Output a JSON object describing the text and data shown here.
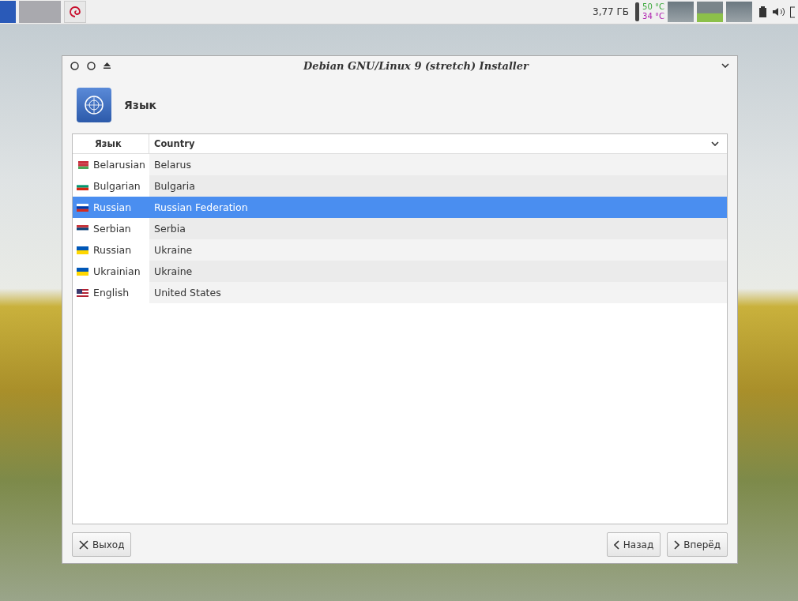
{
  "panel": {
    "memory": "3,77 ГБ",
    "temp_1": "50 °C",
    "temp_2": "34 °C"
  },
  "window": {
    "title": "Debian GNU/Linux 9 (stretch) Installer"
  },
  "header": {
    "title": "Язык"
  },
  "table": {
    "columns": [
      "Язык",
      "Country"
    ],
    "rows": [
      {
        "flag": {
          "kind": "by"
        },
        "language": "Belarusian",
        "country": "Belarus",
        "selected": false
      },
      {
        "flag": {
          "kind": "bg"
        },
        "language": "Bulgarian",
        "country": "Bulgaria",
        "selected": false
      },
      {
        "flag": {
          "kind": "ru"
        },
        "language": "Russian",
        "country": "Russian Federation",
        "selected": true
      },
      {
        "flag": {
          "kind": "rs"
        },
        "language": "Serbian",
        "country": "Serbia",
        "selected": false
      },
      {
        "flag": {
          "kind": "ua"
        },
        "language": "Russian",
        "country": "Ukraine",
        "selected": false
      },
      {
        "flag": {
          "kind": "ua"
        },
        "language": "Ukrainian",
        "country": "Ukraine",
        "selected": false
      },
      {
        "flag": {
          "kind": "us"
        },
        "language": "English",
        "country": "United States",
        "selected": false
      }
    ]
  },
  "buttons": {
    "quit": "Выход",
    "back": "Назад",
    "next": "Вперёд"
  }
}
